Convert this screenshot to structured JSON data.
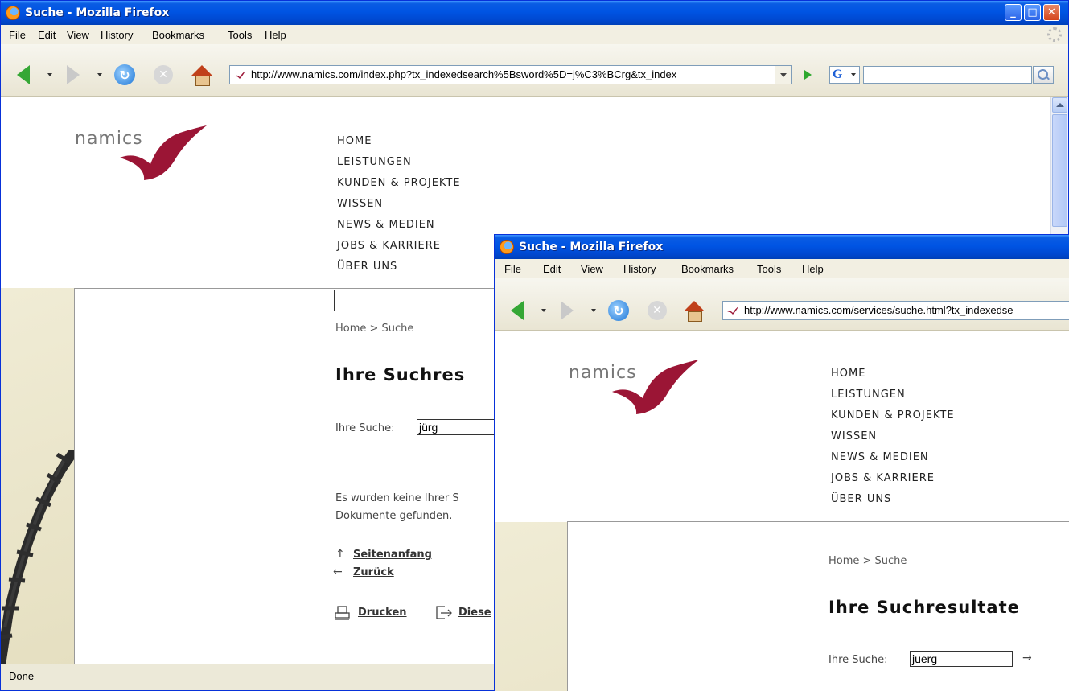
{
  "colors": {
    "title_bar": "#0054e3",
    "brand": "#9b1535",
    "link": "#333333"
  },
  "icons": {
    "back": "green-left-arrow-icon",
    "forward": "gray-right-arrow-icon",
    "reload": "reload-icon",
    "stop": "stop-icon",
    "home": "home-icon",
    "go": "go-arrow-icon",
    "search_engine": "google-icon",
    "search": "magnifier-icon",
    "throbber": "throbber-icon",
    "app": "firefox-icon"
  },
  "window1": {
    "title": "Suche - Mozilla Firefox",
    "menu": [
      "File",
      "Edit",
      "View",
      "History",
      "Bookmarks",
      "Tools",
      "Help"
    ],
    "url": "http://www.namics.com/index.php?tx_indexedsearch%5Bsword%5D=j%C3%BCrg&tx_index",
    "status": "Done",
    "page": {
      "logo": "namics",
      "nav": [
        "HOME",
        "LEISTUNGEN",
        "KUNDEN & PROJEKTE",
        "WISSEN",
        "NEWS & MEDIEN",
        "JOBS & KARRIERE",
        "ÜBER UNS"
      ],
      "breadcrumb": "Home > Suche",
      "heading": "Ihre Suchres",
      "search_label": "Ihre Suche:",
      "search_value": "jürg",
      "result_line1": "Es wurden keine Ihrer S",
      "result_line2": "Dokumente gefunden.",
      "link_top_glyph": "↑",
      "link_top": "Seitenanfang",
      "link_back_glyph": "←",
      "link_back": "Zurück",
      "link_print": "Drucken",
      "link_send": "Diese"
    }
  },
  "window2": {
    "title": "Suche - Mozilla Firefox",
    "menu": [
      "File",
      "Edit",
      "View",
      "History",
      "Bookmarks",
      "Tools",
      "Help"
    ],
    "url": "http://www.namics.com/services/suche.html?tx_indexedse",
    "page": {
      "logo": "namics",
      "nav": [
        "HOME",
        "LEISTUNGEN",
        "KUNDEN & PROJEKTE",
        "WISSEN",
        "NEWS & MEDIEN",
        "JOBS & KARRIERE",
        "ÜBER UNS"
      ],
      "breadcrumb": "Home > Suche",
      "heading": "Ihre Suchresultate",
      "search_label": "Ihre Suche:",
      "search_value": "juerg",
      "submit_glyph": "→"
    }
  }
}
